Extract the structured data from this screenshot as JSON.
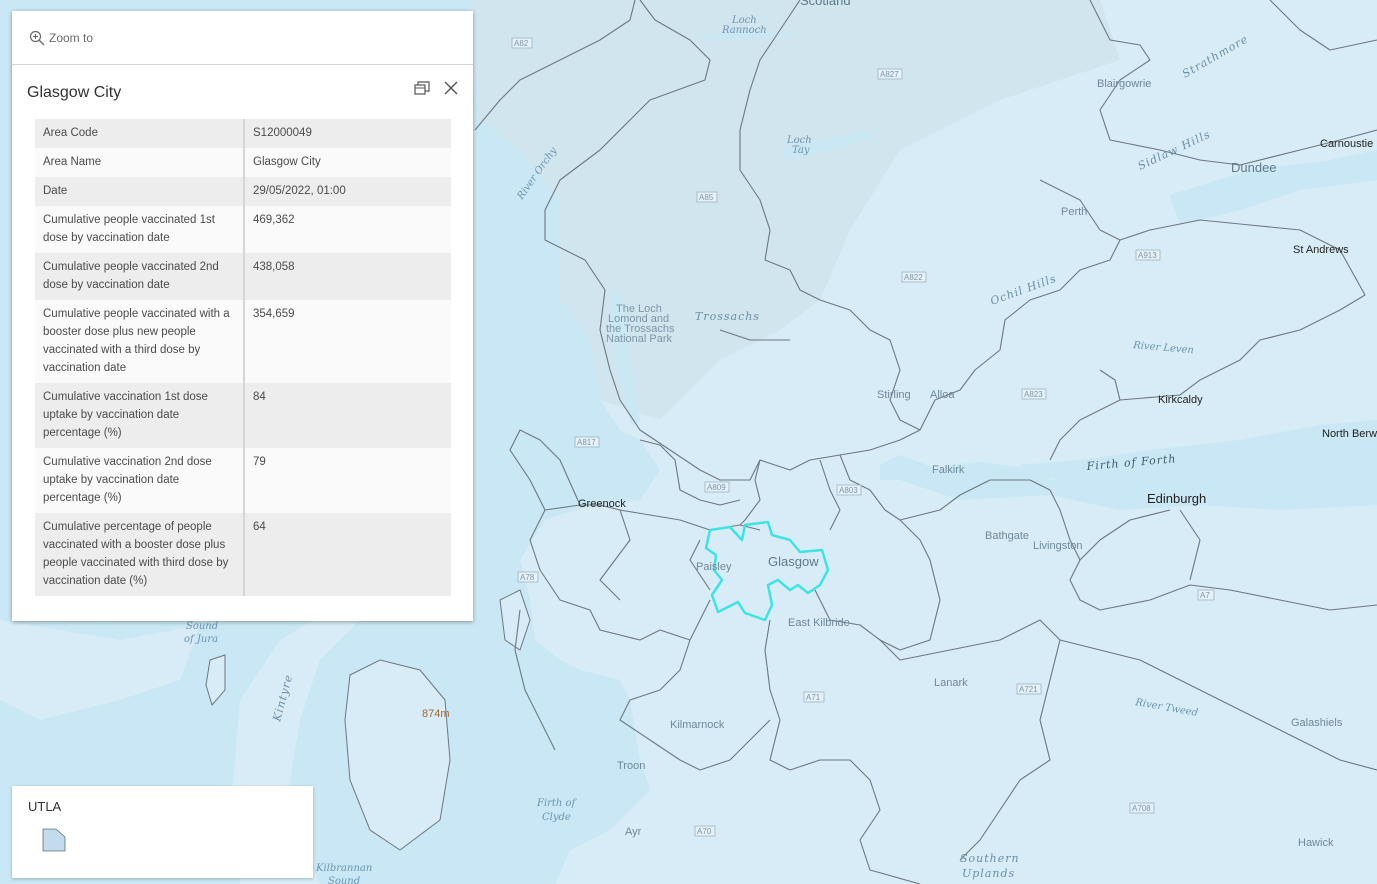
{
  "popup": {
    "zoom_label": "Zoom to",
    "title": "Glasgow City",
    "rows": [
      {
        "field": "Area Code",
        "value": "S12000049"
      },
      {
        "field": "Area Name",
        "value": "Glasgow City"
      },
      {
        "field": "Date",
        "value": "29/05/2022, 01:00"
      },
      {
        "field": "Cumulative people vaccinated 1st dose by vaccination date",
        "value": "469,362"
      },
      {
        "field": "Cumulative people vaccinated 2nd dose by vaccination date",
        "value": "438,058"
      },
      {
        "field": "Cumulative people vaccinated with a booster dose plus new people vaccinated with a third dose by vaccination date",
        "value": "354,659"
      },
      {
        "field": "Cumulative vaccination 1st dose uptake by vaccination date percentage (%)",
        "value": "84"
      },
      {
        "field": "Cumulative vaccination 2nd dose uptake by vaccination date percentage (%)",
        "value": "79"
      },
      {
        "field": "Cumulative percentage of people vaccinated with a booster dose plus people vaccinated with third dose by vaccination date (%)",
        "value": "64"
      }
    ]
  },
  "legend": {
    "title": "UTLA"
  },
  "map": {
    "colors": {
      "water": "#c9e7f4",
      "land": "#d7ecf6",
      "boundary": "#6e7780",
      "highlight": "#3ee3e3"
    },
    "places": {
      "scotland": "Scotland",
      "blairgowrie": "Blairgowrie",
      "carnoustie": "Carnoustie",
      "dundee": "Dundee",
      "perth": "Perth",
      "st_andrews": "St Andrews",
      "stirling": "Stirling",
      "alloa": "Alloa",
      "kirkcaldy": "Kirkcaldy",
      "north_berwick": "North Berwi",
      "falkirk": "Falkirk",
      "greenock": "Greenock",
      "glasgow": "Glasgow",
      "paisley": "Paisley",
      "east_kilbride": "East Kilbride",
      "bathgate": "Bathgate",
      "livingston": "Livingston",
      "edinburgh": "Edinburgh",
      "lanark": "Lanark",
      "kilmarnock": "Kilmarnock",
      "troon": "Troon",
      "ayr": "Ayr",
      "galashiels": "Galashiels",
      "hawick": "Hawick",
      "kintyre": "Kintyre",
      "trossachs": "Trossachs",
      "national_park": [
        "The Loch",
        "Lomond and",
        "the Trossachs",
        "National Park"
      ],
      "ochil_hills": "Ochil Hills",
      "sidlaw_hills": "Sidlaw Hills",
      "strathmore": "Strathmore",
      "southern_uplands": [
        "Southern",
        "Uplands"
      ],
      "peak": "874m"
    },
    "water": {
      "loch_rannoch": [
        "Loch",
        "Rannoch"
      ],
      "loch_tay": [
        "Loch",
        "Tay"
      ],
      "river_orchy": "River Orchy",
      "river_leven": "River Leven",
      "river_tweed": "River Tweed",
      "firth_of_forth": "Firth of Forth",
      "firth_of_clyde": [
        "Firth of",
        "Clyde"
      ],
      "sound_of_jura": [
        "Sound",
        "of Jura"
      ],
      "kilbrannan_sound": [
        "Kilbrannan",
        "Sound"
      ]
    },
    "roads": {
      "a82": "A82",
      "a827": "A827",
      "a85": "A85",
      "a822": "A822",
      "a913": "A913",
      "a823": "A823",
      "a817": "A817",
      "a809": "A809",
      "a803": "A803",
      "a78": "A78",
      "a71": "A71",
      "a721": "A721",
      "a7": "A7",
      "a70": "A70",
      "a708": "A708"
    }
  }
}
